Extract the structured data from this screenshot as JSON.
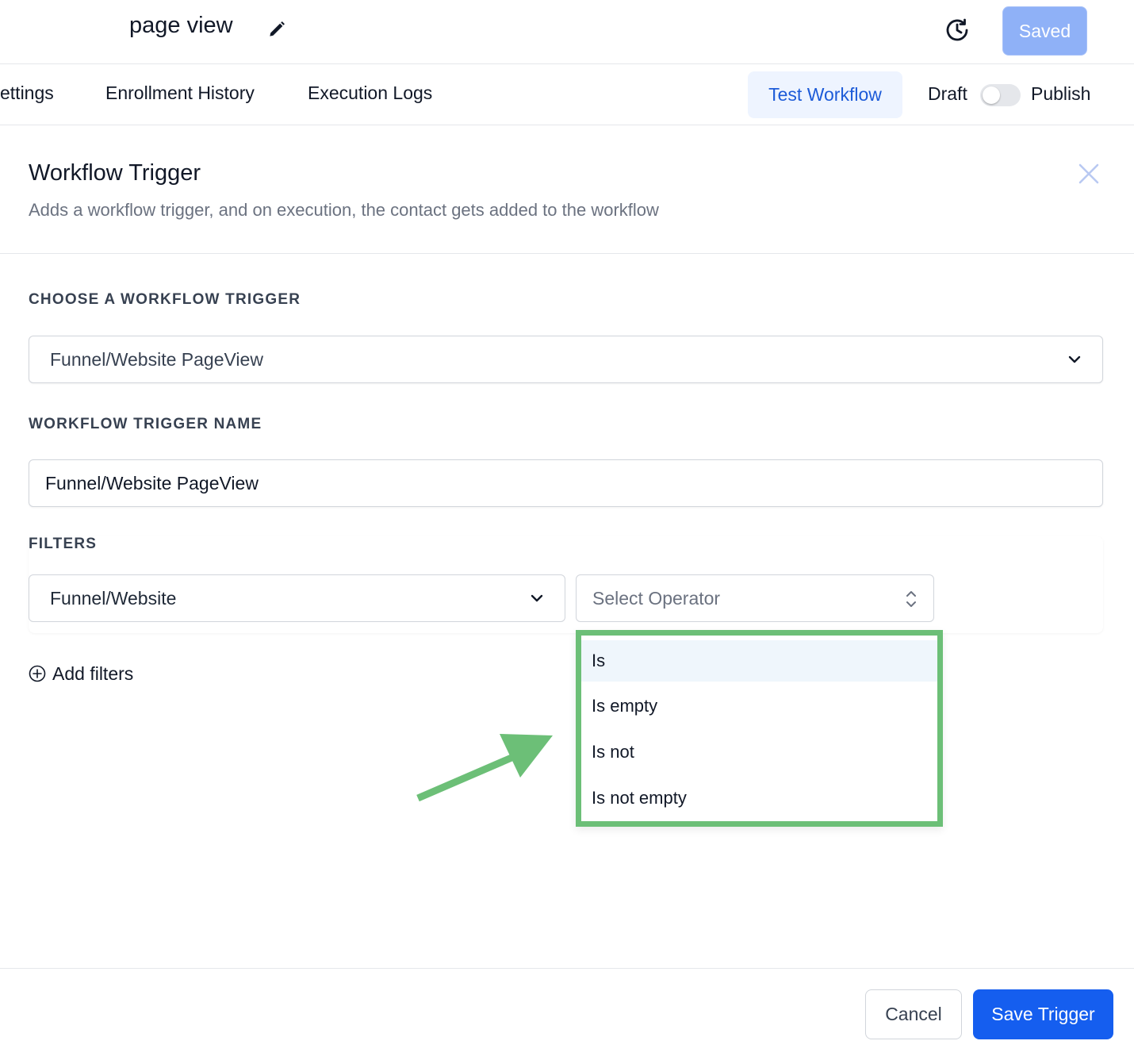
{
  "header": {
    "workflow_title": "page view",
    "saved_label": "Saved"
  },
  "tabs": [
    {
      "label": "ettings"
    },
    {
      "label": "Enrollment History"
    },
    {
      "label": "Execution Logs"
    }
  ],
  "toolbar": {
    "test_label": "Test Workflow",
    "draft_label": "Draft",
    "publish_label": "Publish",
    "publish_enabled": false
  },
  "panel": {
    "title": "Workflow Trigger",
    "subtitle": "Adds a workflow trigger, and on execution, the contact gets added to the workflow"
  },
  "form": {
    "choose_trigger_label": "CHOOSE A WORKFLOW TRIGGER",
    "choose_trigger_value": "Funnel/Website PageView",
    "trigger_name_label": "WORKFLOW TRIGGER NAME",
    "trigger_name_value": "Funnel/Website PageView",
    "filters_label": "FILTERS",
    "filter_field_value": "Funnel/Website",
    "operator_placeholder": "Select Operator",
    "add_filters_label": "Add filters"
  },
  "operator_options": [
    {
      "label": "Is",
      "highlighted": true
    },
    {
      "label": "Is empty"
    },
    {
      "label": "Is not"
    },
    {
      "label": "Is not empty"
    }
  ],
  "footer": {
    "cancel_label": "Cancel",
    "save_label": "Save Trigger"
  },
  "colors": {
    "primary": "#155eef",
    "saved_button": "#8fb1f7",
    "test_button_bg": "#eef4ff",
    "annotation_green": "#6cbf77",
    "option_highlight": "#eff6fc"
  },
  "icons": {
    "edit": "pencil-icon",
    "history": "history-icon",
    "close": "close-icon",
    "chevron": "chevron-down-icon",
    "sort": "sort-icon",
    "add": "plus-circle-icon"
  }
}
